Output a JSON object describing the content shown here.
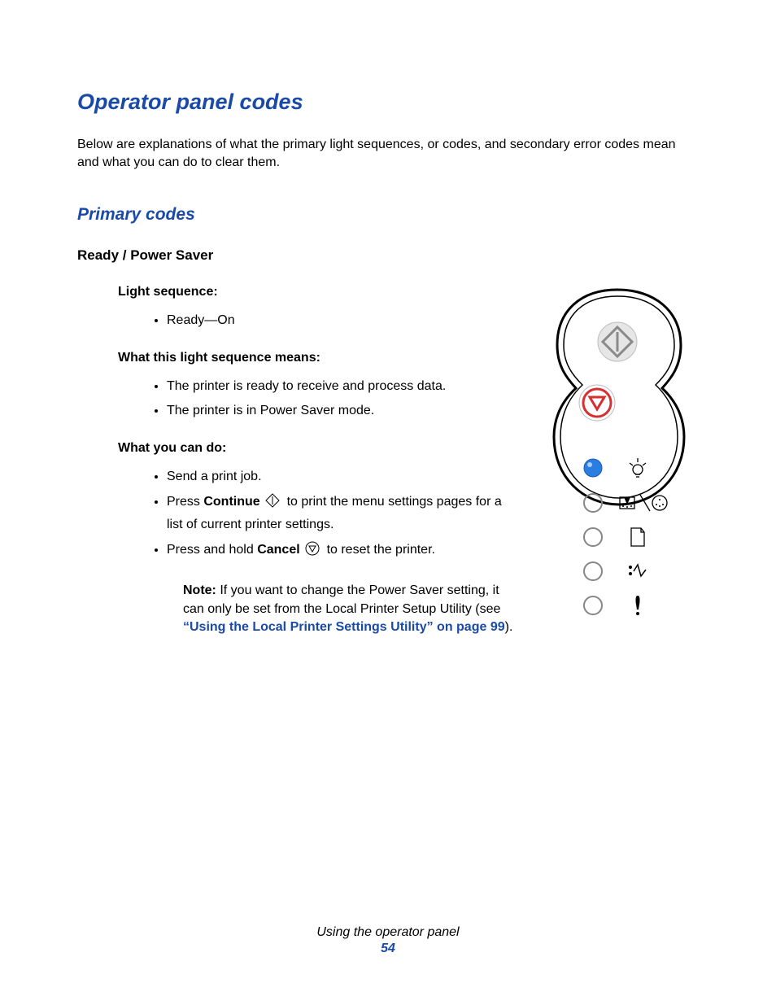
{
  "title": "Operator panel codes",
  "intro": "Below are explanations of what the primary light sequences, or codes, and secondary error codes mean and what you can do to clear them.",
  "section_primary": "Primary codes",
  "topic_title": "Ready / Power Saver",
  "light_seq_heading": "Light sequence:",
  "light_seq_item": "Ready—On",
  "means_heading": "What this light sequence means:",
  "means_items": {
    "0": "The printer is ready to receive and process data.",
    "1": "The printer is in Power Saver mode."
  },
  "do_heading": "What you can do:",
  "do_items": {
    "0": "Send a print job.",
    "1_pre": "Press ",
    "1_bold": "Continue",
    "1_post": " to print the menu settings pages for a list of current printer settings.",
    "2_pre": "Press and hold ",
    "2_bold": "Cancel",
    "2_post": " to reset the printer."
  },
  "note_label": "Note:",
  "note_text_pre": " If you want to change the Power Saver setting, it can only be set from the Local Printer Setup Utility (see ",
  "note_link": "“Using the Local Printer Settings Utility” on page 99",
  "note_text_post": ").",
  "footer_title": "Using the operator panel",
  "footer_page": "54"
}
